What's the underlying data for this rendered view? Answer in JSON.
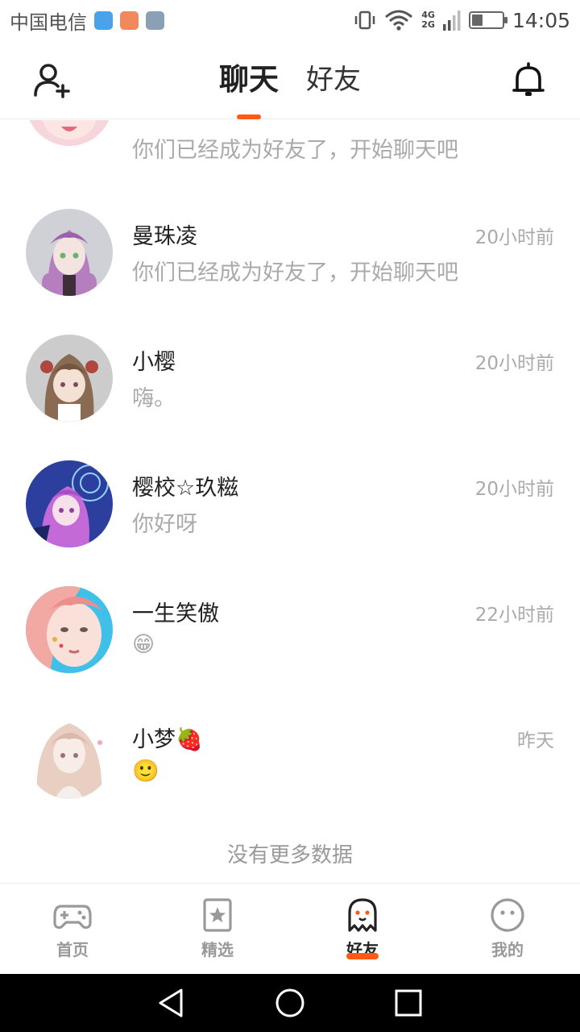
{
  "status_bar": {
    "carrier": "中国电信",
    "network_top": "4G",
    "network_bottom": "2G",
    "time": "14:05",
    "battery_level": 0.35,
    "app_icon_colors": [
      "#4aa3e8",
      "#f08a5d",
      "#8aa0b4"
    ]
  },
  "header": {
    "tabs": [
      {
        "label": "聊天",
        "active": true
      },
      {
        "label": "好友",
        "active": false
      }
    ],
    "add_friend_icon": "add-user-icon",
    "bell_icon": "bell-icon",
    "accent_color": "#ff5a14"
  },
  "chats": [
    {
      "name": "",
      "time": "",
      "message": "你们已经成为好友了，开始聊天吧",
      "avatar_palette": [
        "#f6d6dc",
        "#f3b7c4",
        "#ffffff"
      ]
    },
    {
      "name": "曼珠凌",
      "time": "20小时前",
      "message": "你们已经成为好友了，开始聊天吧",
      "avatar_palette": [
        "#cfd1d6",
        "#b57fbf",
        "#5b4a5e"
      ]
    },
    {
      "name": "小樱",
      "time": "20小时前",
      "message": "嗨。",
      "avatar_palette": [
        "#cccccc",
        "#8a6a52",
        "#f3e1d4"
      ]
    },
    {
      "name": "樱校☆玖糍",
      "time": "20小时前",
      "message": "你好呀",
      "avatar_palette": [
        "#2c3e9e",
        "#c46ad8",
        "#8fd3f2"
      ]
    },
    {
      "name": "一生笑傲",
      "time": "22小时前",
      "message": "😁",
      "avatar_palette": [
        "#40c0e8",
        "#f2a9a4",
        "#f9e1d9"
      ]
    },
    {
      "name": "小梦🍓",
      "time": "昨天",
      "message": "🙂",
      "avatar_palette": [
        "#f4efec",
        "#e8cfc2",
        "#d9b9a8"
      ]
    }
  ],
  "no_more_text": "没有更多数据",
  "bottom_nav": [
    {
      "label": "首页",
      "icon": "gamepad-icon",
      "active": false
    },
    {
      "label": "精选",
      "icon": "star-bookmark-icon",
      "active": false
    },
    {
      "label": "好友",
      "icon": "ghost-icon",
      "active": true
    },
    {
      "label": "我的",
      "icon": "smiley-face-icon",
      "active": false
    }
  ],
  "system_nav": [
    "back-icon",
    "home-icon",
    "recents-icon"
  ]
}
